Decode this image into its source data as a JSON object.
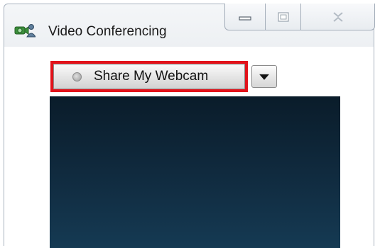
{
  "window": {
    "title": "Video Conferencing",
    "icon": "webcam-people-icon",
    "caption_buttons": [
      "minimize-icon",
      "maximize-icon",
      "close-icon"
    ]
  },
  "toolbar": {
    "share_label": "Share My Webcam",
    "share_status_icon": "status-dot-icon",
    "dropdown_icon": "chevron-down-icon",
    "highlight_color": "#e2131b"
  },
  "video": {
    "background_color": "#112d42"
  }
}
